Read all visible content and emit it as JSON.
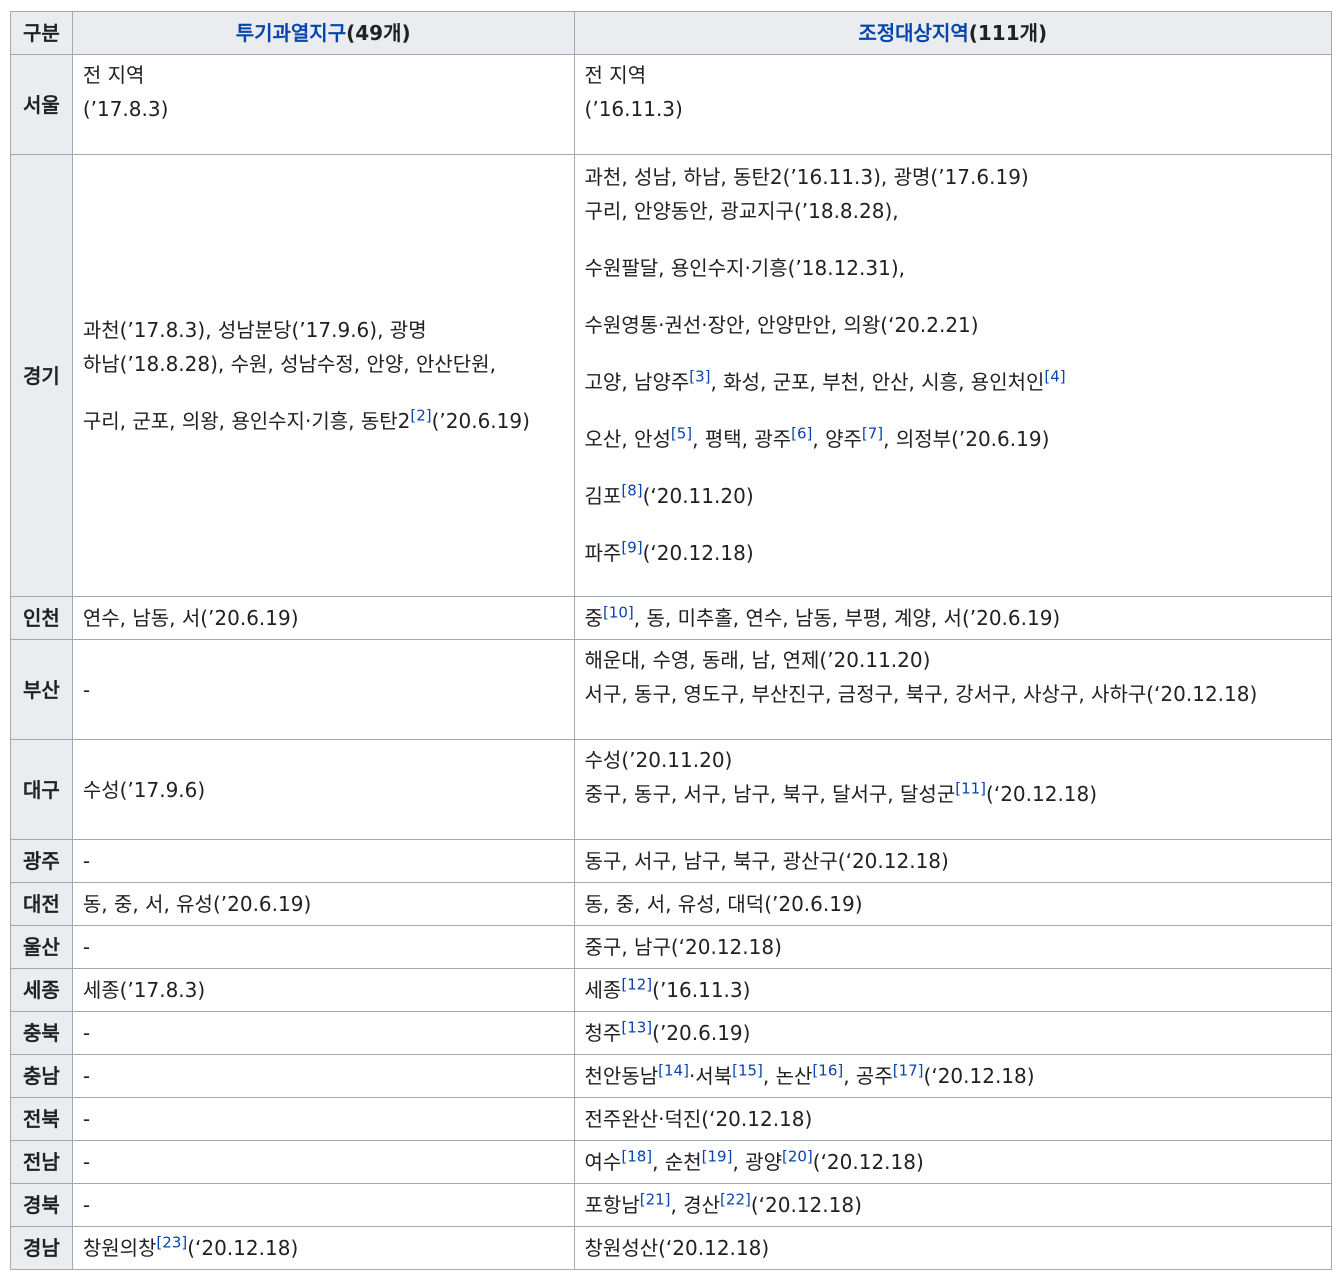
{
  "header": {
    "col1": "구분",
    "col2_link": "투기과열지구",
    "col2_count": "(49개)",
    "col3_link": "조정대상지역",
    "col3_count": "(111개)"
  },
  "rows": [
    {
      "region": "서울",
      "a": [
        [
          "전 지역"
        ],
        [
          "(’17.8.3)"
        ]
      ],
      "b": [
        [
          "전 지역"
        ],
        [
          "(’16.11.3)"
        ]
      ]
    },
    {
      "region": "경기",
      "a": [
        [
          "과천(’17.8.3), 성남분당(’17.9.6), 광명"
        ],
        [
          "하남(’18.8.28), 수원, 성남수정, 안양, 안산단원,"
        ],
        [
          "구리, 군포, 의왕, 용인수지·기흥, 동탄2",
          "[2]",
          "(’20.6.19)"
        ]
      ],
      "b": [
        [
          "과천, 성남, 하남, 동탄2(’16.11.3), 광명(’17.6.19)"
        ],
        [
          "구리, 안양동안, 광교지구(’18.8.28),"
        ],
        [
          "수원팔달, 용인수지·기흥(’18.12.31),"
        ],
        [
          "수원영통·권선·장안, 안양만안, 의왕(‘20.2.21)"
        ],
        [
          "고양, 남양주",
          "[3]",
          ", 화성, 군포, 부천, 안산, 시흥, 용인처인",
          "[4]"
        ],
        [
          "오산, 안성",
          "[5]",
          ", 평택, 광주",
          "[6]",
          ", 양주",
          "[7]",
          ", 의정부(’20.6.19)"
        ],
        [
          "김포",
          "[8]",
          "(‘20.11.20)"
        ],
        [
          "파주",
          "[9]",
          "(‘20.12.18)"
        ]
      ]
    },
    {
      "region": "인천",
      "a": [
        [
          "연수, 남동, 서(’20.6.19)"
        ]
      ],
      "b": [
        [
          "중",
          "[10]",
          ", 동, 미추홀, 연수, 남동, 부평, 계양, 서(’20.6.19)"
        ]
      ]
    },
    {
      "region": "부산",
      "a": [
        [
          "-"
        ]
      ],
      "b": [
        [
          "해운대, 수영, 동래, 남, 연제(’20.11.20)"
        ],
        [
          "서구, 동구, 영도구, 부산진구, 금정구, 북구, 강서구, 사상구, 사하구(‘20.12.18)"
        ]
      ]
    },
    {
      "region": "대구",
      "a": [
        [
          "수성(’17.9.6)"
        ]
      ],
      "b": [
        [
          "수성(’20.11.20)"
        ],
        [
          "중구, 동구, 서구, 남구, 북구, 달서구, 달성군",
          "[11]",
          "(‘20.12.18)"
        ]
      ]
    },
    {
      "region": "광주",
      "a": [
        [
          "-"
        ]
      ],
      "b": [
        [
          "동구, 서구, 남구, 북구, 광산구(‘20.12.18)"
        ]
      ]
    },
    {
      "region": "대전",
      "a": [
        [
          "동, 중, 서, 유성(’20.6.19)"
        ]
      ],
      "b": [
        [
          "동, 중, 서, 유성, 대덕(’20.6.19)"
        ]
      ]
    },
    {
      "region": "울산",
      "a": [
        [
          "-"
        ]
      ],
      "b": [
        [
          "중구, 남구(‘20.12.18)"
        ]
      ]
    },
    {
      "region": "세종",
      "a": [
        [
          "세종(’17.8.3)"
        ]
      ],
      "b": [
        [
          "세종",
          "[12]",
          "(’16.11.3)"
        ]
      ]
    },
    {
      "region": "충북",
      "a": [
        [
          "-"
        ]
      ],
      "b": [
        [
          "청주",
          "[13]",
          "(’20.6.19)"
        ]
      ]
    },
    {
      "region": "충남",
      "a": [
        [
          "-"
        ]
      ],
      "b": [
        [
          "천안동남",
          "[14]",
          "·서북",
          "[15]",
          ", 논산",
          "[16]",
          ", 공주",
          "[17]",
          "(‘20.12.18)"
        ]
      ]
    },
    {
      "region": "전북",
      "a": [
        [
          "-"
        ]
      ],
      "b": [
        [
          "전주완산·덕진(‘20.12.18)"
        ]
      ]
    },
    {
      "region": "전남",
      "a": [
        [
          "-"
        ]
      ],
      "b": [
        [
          "여수",
          "[18]",
          ", 순천",
          "[19]",
          ", 광양",
          "[20]",
          "(‘20.12.18)"
        ]
      ]
    },
    {
      "region": "경북",
      "a": [
        [
          "-"
        ]
      ],
      "b": [
        [
          "포항남",
          "[21]",
          ", 경산",
          "[22]",
          "(‘20.12.18)"
        ]
      ]
    },
    {
      "region": "경남",
      "a": [
        [
          "창원의창",
          "[23]",
          "(‘20.12.18)"
        ]
      ],
      "b": [
        [
          "창원성산(‘20.12.18)"
        ]
      ]
    }
  ]
}
